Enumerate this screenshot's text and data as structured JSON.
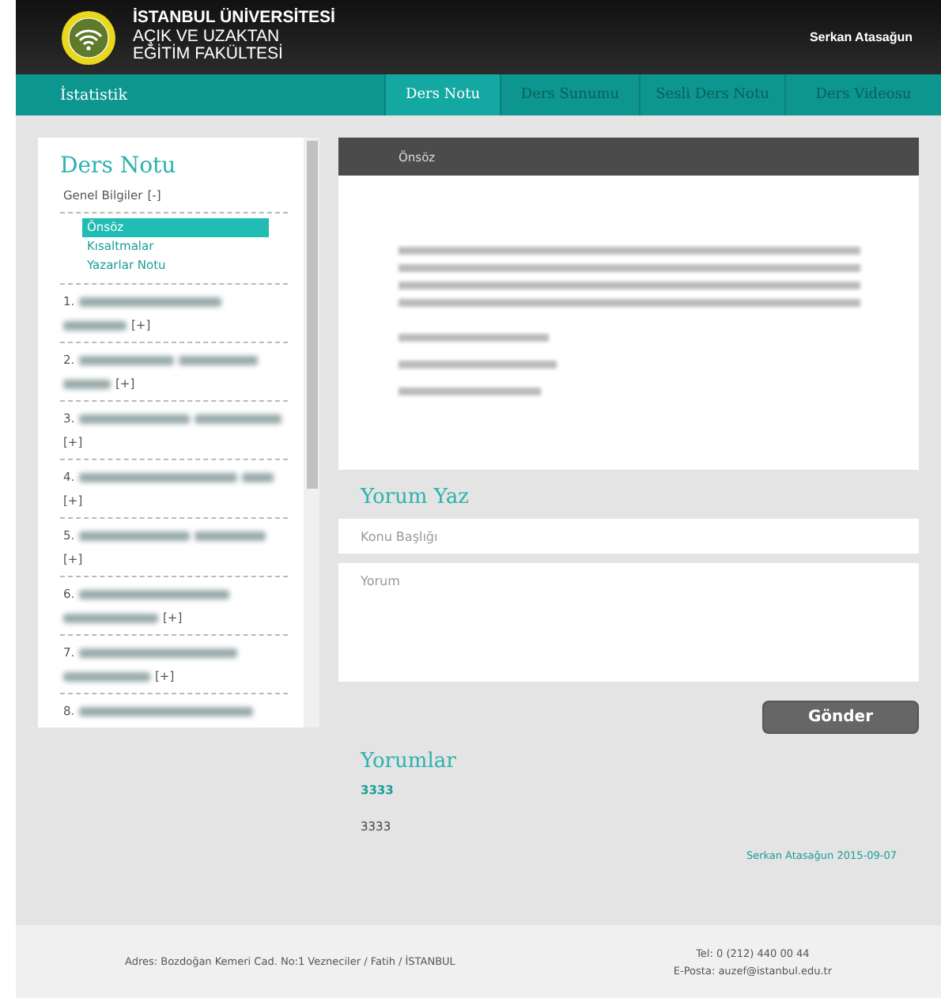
{
  "header": {
    "logo_lines": [
      "İSTANBUL ÜNİVERSİTESİ",
      "AÇIK VE UZAKTAN",
      "EĞİTİM FAKÜLTESİ"
    ],
    "user": "Serkan Atasağun"
  },
  "nav": {
    "left": "İstatistik",
    "tabs": [
      {
        "label": "Ders Notu",
        "selected": true
      },
      {
        "label": "Ders Sunumu",
        "selected": false
      },
      {
        "label": "Sesli Ders Notu",
        "selected": false
      },
      {
        "label": "Ders Videosu",
        "selected": false
      }
    ]
  },
  "sidebar": {
    "title": "Ders Notu",
    "sections": [
      {
        "label": "Genel Bilgiler",
        "toggle": "[-]",
        "children": [
          {
            "label": "Önsöz",
            "selected": true
          },
          {
            "label": "Kısaltmalar",
            "selected": false
          },
          {
            "label": "Yazarlar Notu",
            "selected": false
          }
        ]
      },
      {
        "label": "1.",
        "toggle": "[+]"
      },
      {
        "label": "2.",
        "toggle": "[+]"
      },
      {
        "label": "3.",
        "toggle": "[+]"
      },
      {
        "label": "4.",
        "toggle": "[+]"
      },
      {
        "label": "5.",
        "toggle": "[+]"
      },
      {
        "label": "6.",
        "toggle": "[+]"
      },
      {
        "label": "7.",
        "toggle": "[+]"
      },
      {
        "label": "8."
      }
    ]
  },
  "content": {
    "title": "Önsöz"
  },
  "comment_form": {
    "title": "Yorum Yaz",
    "subject_placeholder": "Konu Başlığı",
    "body_placeholder": "Yorum",
    "submit": "Gönder"
  },
  "comments": {
    "title": "Yorumlar",
    "items": [
      {
        "title": "3333",
        "body": "3333",
        "meta": "Serkan Atasağun 2015-09-07"
      }
    ]
  },
  "footer": {
    "address": "Adres: Bozdoğan Kemeri Cad. No:1 Vezneciler / Fatih / İSTANBUL",
    "phone": "Tel: 0 (212) 440 00 44",
    "email": "E-Posta: auzef@istanbul.edu.tr"
  }
}
